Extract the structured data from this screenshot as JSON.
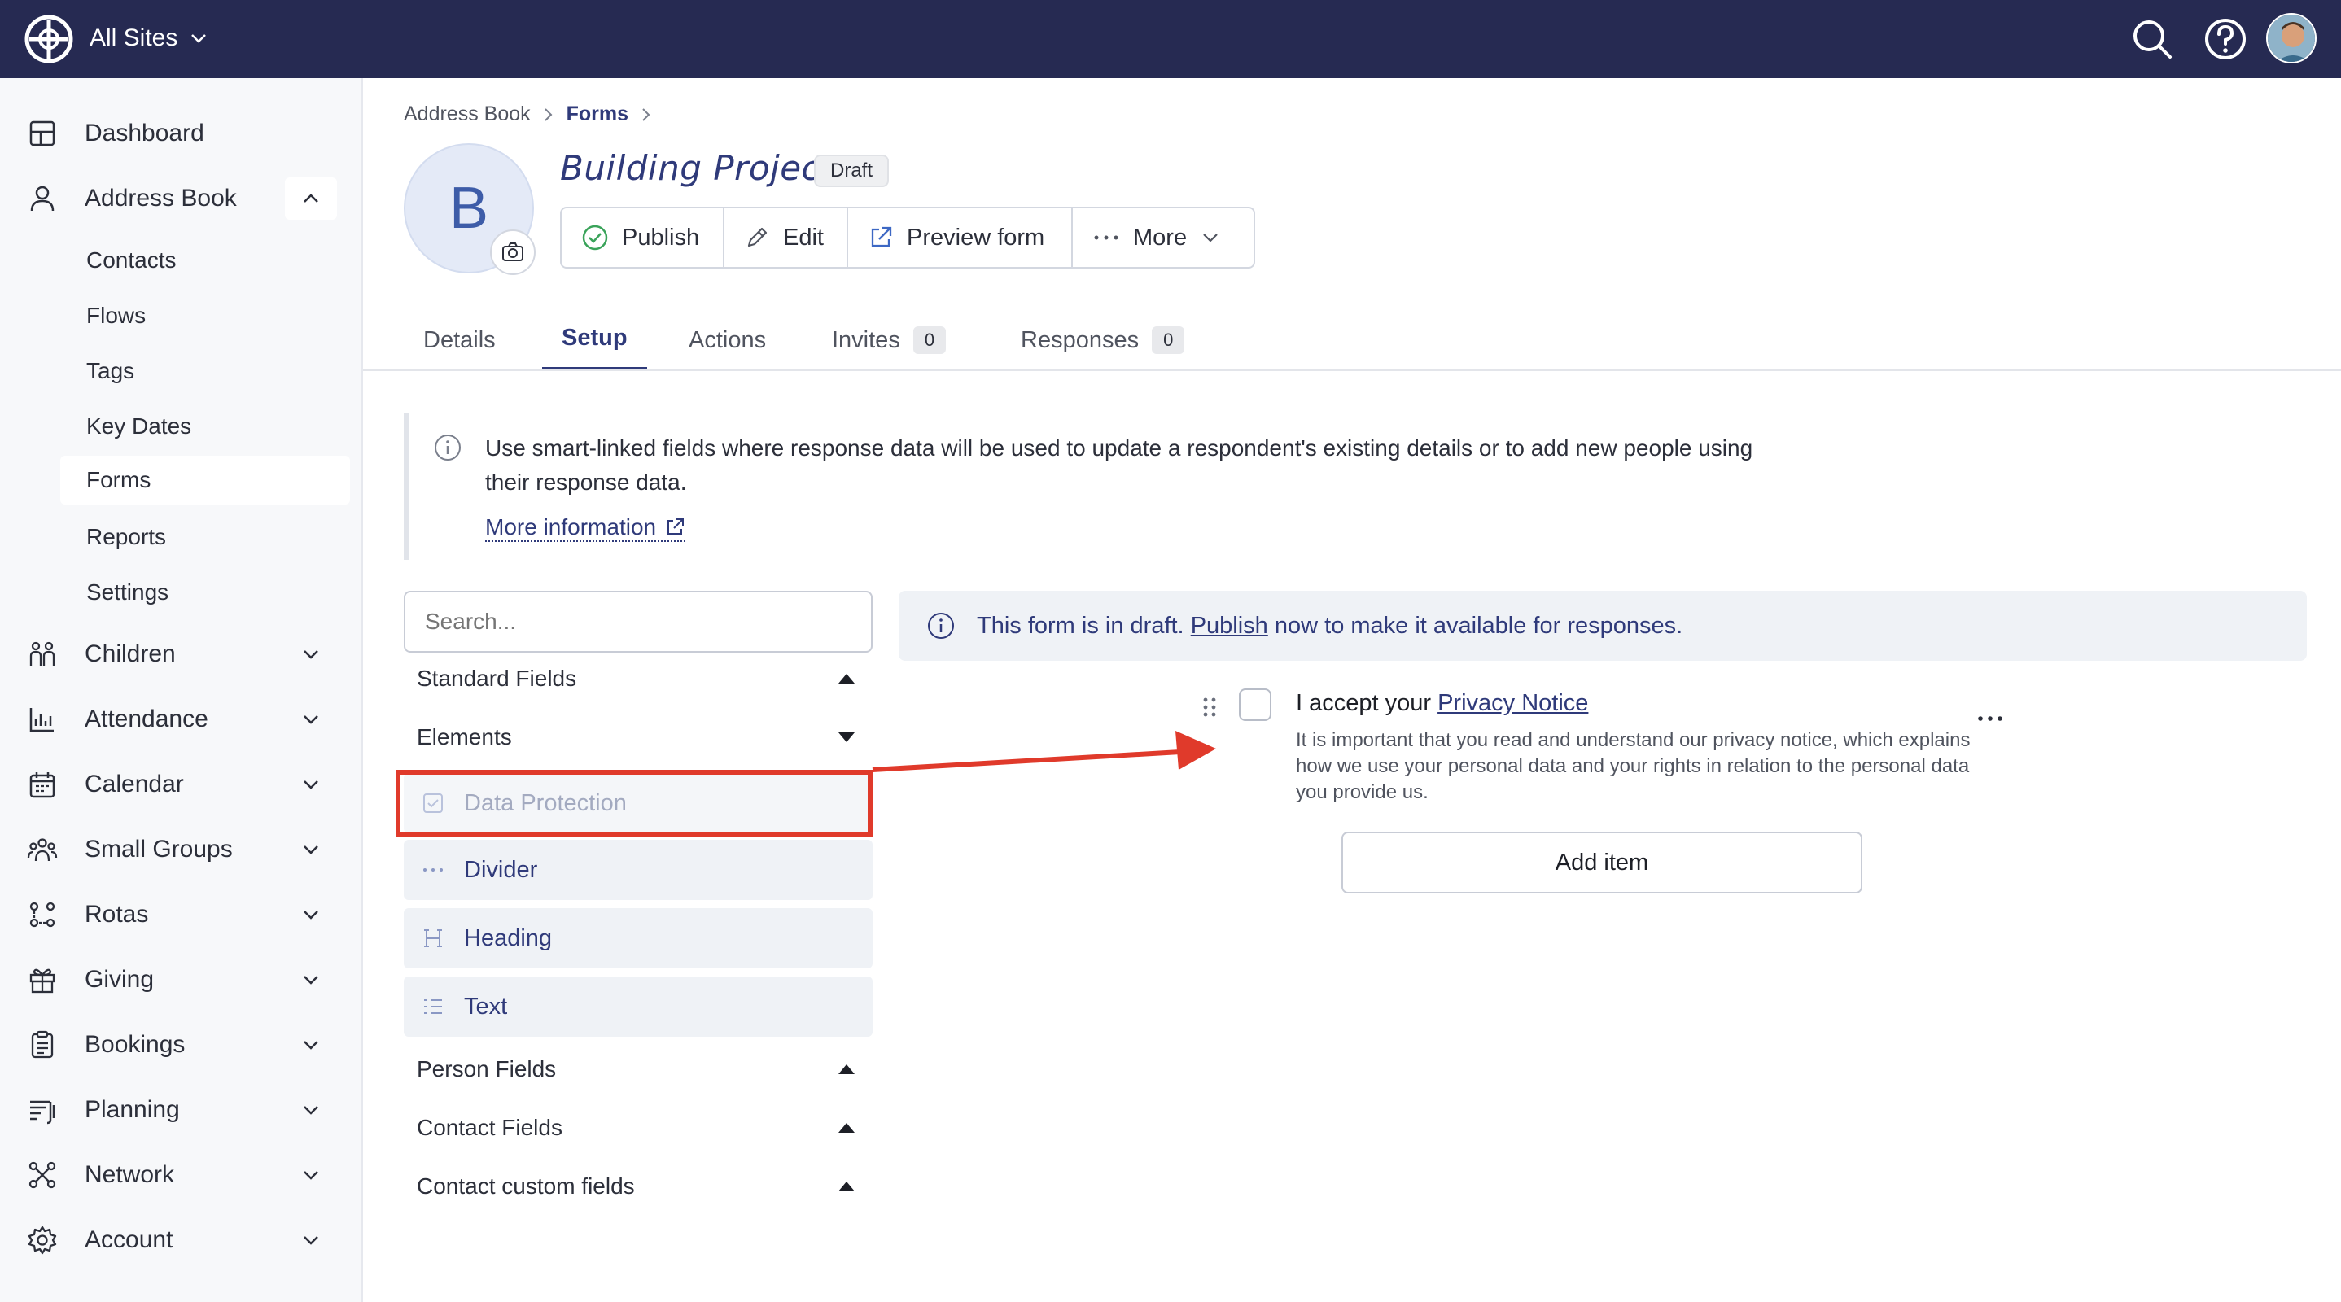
{
  "topbar": {
    "site_switch": "All Sites"
  },
  "sidebar": {
    "dashboard": "Dashboard",
    "address_book": "Address Book",
    "sub_items": [
      "Contacts",
      "Flows",
      "Tags",
      "Key Dates",
      "Forms",
      "Reports",
      "Settings"
    ],
    "sections": [
      "Children",
      "Attendance",
      "Calendar",
      "Small Groups",
      "Rotas",
      "Giving",
      "Bookings",
      "Planning",
      "Network",
      "Account"
    ]
  },
  "breadcrumb": {
    "root": "Address Book",
    "current": "Forms"
  },
  "form": {
    "avatar_letter": "B",
    "title": "Building Project",
    "status": "Draft"
  },
  "actions": {
    "publish": "Publish",
    "edit": "Edit",
    "preview": "Preview form",
    "more": "More"
  },
  "tabs": {
    "details": "Details",
    "setup": "Setup",
    "actions": "Actions",
    "invites": "Invites",
    "invites_count": "0",
    "responses": "Responses",
    "responses_count": "0"
  },
  "info": {
    "text": "Use smart-linked fields where response data will be used to update a respondent's existing details or to add new people using their response data.",
    "link": "More information"
  },
  "palette": {
    "search_placeholder": "Search...",
    "standard_fields": "Standard Fields",
    "elements": "Elements",
    "element_items": [
      "Data Protection",
      "Divider",
      "Heading",
      "Text"
    ],
    "person_fields": "Person Fields",
    "contact_fields": "Contact Fields",
    "contact_custom_fields": "Contact custom fields"
  },
  "preview": {
    "notice_before": "This form is in draft.",
    "notice_link": "Publish",
    "notice_after": "now to make it available for responses.",
    "consent_prefix": "I accept your",
    "consent_link": "Privacy Notice",
    "consent_desc": "It is important that you read and understand our privacy notice, which explains how we use your personal data and your rights in relation to the personal data you provide us.",
    "add_item": "Add item"
  },
  "colors": {
    "topbar": "#262a52",
    "accent": "#2f3a7a",
    "highlight": "#e03a2b"
  }
}
